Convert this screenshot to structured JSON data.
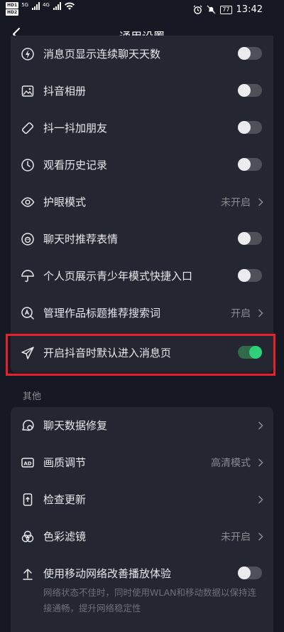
{
  "status_bar": {
    "hd1": "HD1",
    "hd2": "HD2",
    "signal1": "5G",
    "signal2": "4G",
    "battery": "77",
    "time": "13:42"
  },
  "nav": {
    "title": "通用设置"
  },
  "settings_top": [
    {
      "label": "消息页显示连续聊天天数",
      "icon": "lightning-icon",
      "control": "toggle",
      "on": false
    },
    {
      "label": "抖音相册",
      "icon": "photo-icon",
      "control": "toggle",
      "on": false
    },
    {
      "label": "抖一抖加朋友",
      "icon": "shake-icon",
      "control": "toggle",
      "on": false
    },
    {
      "label": "观看历史记录",
      "icon": "clock-icon",
      "control": "toggle",
      "on": false
    },
    {
      "label": "护眼模式",
      "icon": "eye-icon",
      "control": "link",
      "value": "未开启"
    },
    {
      "label": "聊天时推荐表情",
      "icon": "emoji-icon",
      "control": "toggle",
      "on": false
    },
    {
      "label": "个人页展示青少年模式快捷入口",
      "icon": "umbrella-icon",
      "control": "toggle",
      "on": false
    },
    {
      "label": "管理作品标题推荐搜索词",
      "icon": "search-a-icon",
      "control": "link",
      "value": "开启"
    },
    {
      "label": "开启抖音时默认进入消息页",
      "icon": "send-icon",
      "control": "toggle",
      "on": true
    }
  ],
  "section_other": "其他",
  "settings_other": [
    {
      "label": "聊天数据修复",
      "icon": "chat-repair-icon",
      "control": "link",
      "value": ""
    },
    {
      "label": "画质调节",
      "icon": "ad-quality-icon",
      "control": "link",
      "value": "高清模式"
    },
    {
      "label": "检查更新",
      "icon": "update-icon",
      "control": "link",
      "value": ""
    },
    {
      "label": "色彩滤镜",
      "icon": "color-filter-icon",
      "control": "link",
      "value": "未开启"
    },
    {
      "label": "使用移动网络改善播放体验",
      "icon": "upload-arrow-icon",
      "control": "toggle",
      "on": false
    }
  ],
  "network_desc": "网络状态不佳时，同时使用WLAN和移动数据以保持连接通畅，提升网络稳定性"
}
